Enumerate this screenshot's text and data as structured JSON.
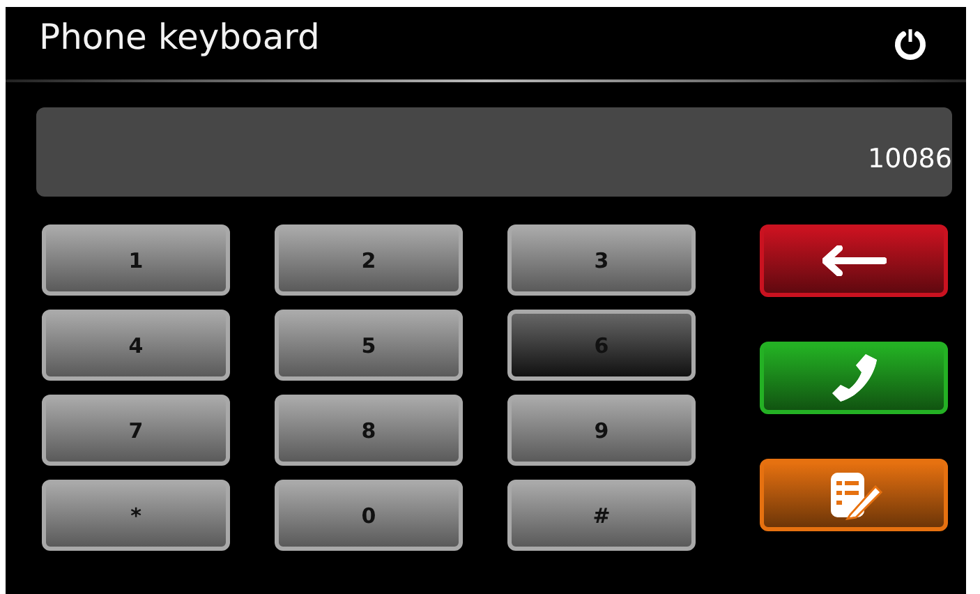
{
  "window": {
    "title": "Phone keyboard"
  },
  "display": {
    "value": "10086"
  },
  "keys": [
    {
      "label": "1",
      "pressed": false
    },
    {
      "label": "2",
      "pressed": false
    },
    {
      "label": "3",
      "pressed": false
    },
    {
      "label": "4",
      "pressed": false
    },
    {
      "label": "5",
      "pressed": false
    },
    {
      "label": "6",
      "pressed": true
    },
    {
      "label": "7",
      "pressed": false
    },
    {
      "label": "8",
      "pressed": false
    },
    {
      "label": "9",
      "pressed": false
    },
    {
      "label": "*",
      "pressed": false
    },
    {
      "label": "0",
      "pressed": false
    },
    {
      "label": "#",
      "pressed": false
    }
  ],
  "actions": [
    {
      "kind": "backspace",
      "color": "#b0101c"
    },
    {
      "kind": "call",
      "color": "#1f9a1f"
    },
    {
      "kind": "contacts",
      "color": "#c8620e"
    }
  ]
}
